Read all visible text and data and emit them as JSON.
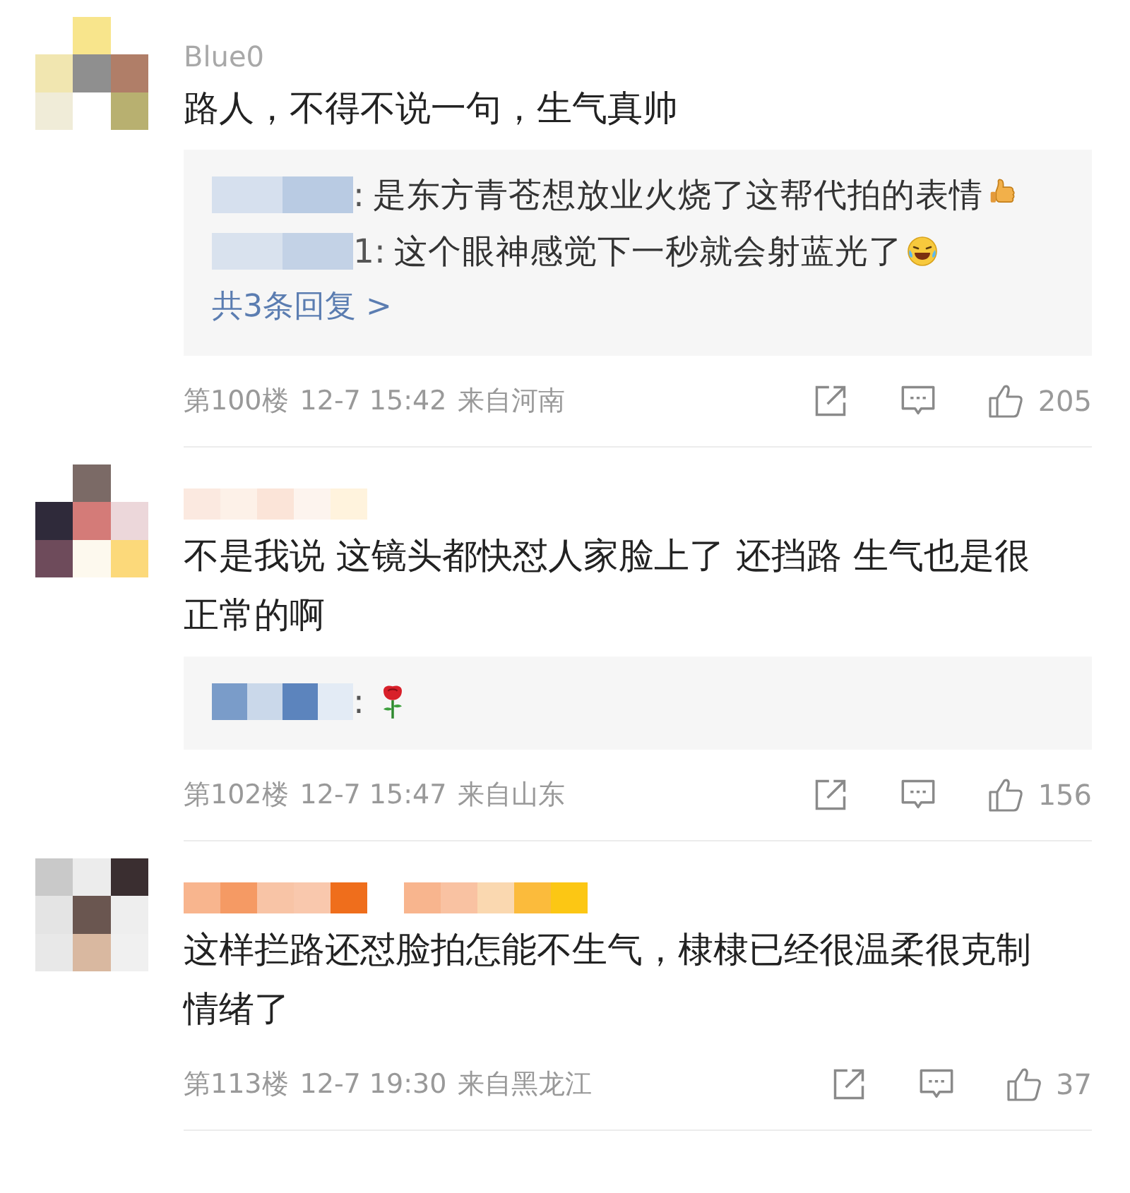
{
  "comments": [
    {
      "author": "Blue0",
      "body": "路人，不得不说一句，生气真帅",
      "replies": [
        {
          "name_tail": ":",
          "text": "是东方青苍想放业火烧了这帮代拍的表情",
          "emoji": {
            "kind": "thumbs-up"
          }
        },
        {
          "name_tail": "1:",
          "text": "这个眼神感觉下一秒就会射蓝光了",
          "emoji": {
            "kind": "laughing"
          }
        }
      ],
      "more_replies": "共3条回复 >",
      "floor": "第100楼",
      "time": "12-7 15:42",
      "location": "来自河南",
      "likes": "205"
    },
    {
      "body": "不是我说 这镜头都快怼人家脸上了 还挡路 生气也是很正常的啊",
      "replies": [
        {
          "name_tail": ":",
          "emoji": {
            "kind": "rose"
          }
        }
      ],
      "floor": "第102楼",
      "time": "12-7 15:47",
      "location": "来自山东",
      "likes": "156"
    },
    {
      "body": "这样拦路还怼脸拍怎能不生气，棣棣已经很温柔很克制情绪了",
      "floor": "第113楼",
      "time": "12-7 19:30",
      "location": "来自黑龙江",
      "likes": "37"
    }
  ]
}
